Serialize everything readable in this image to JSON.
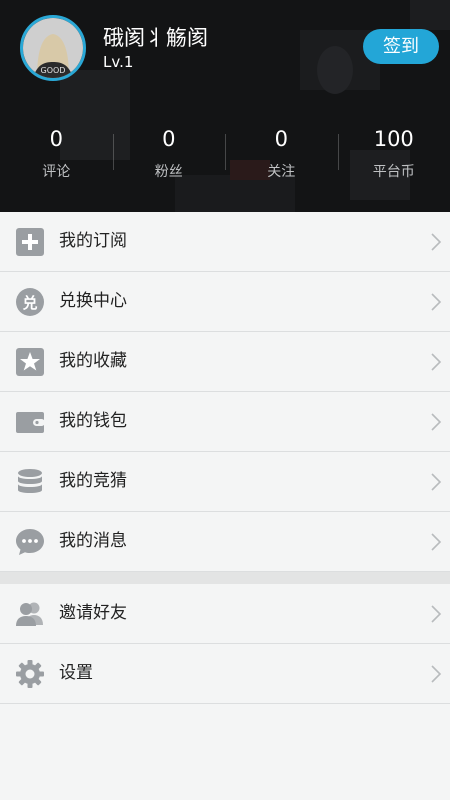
{
  "profile": {
    "username": "硪阂丬觞阂",
    "level": "Lv.1",
    "signin_label": "签到"
  },
  "stats": [
    {
      "value": "0",
      "label": "评论"
    },
    {
      "value": "0",
      "label": "粉丝"
    },
    {
      "value": "0",
      "label": "关注"
    },
    {
      "value": "100",
      "label": "平台币"
    }
  ],
  "menu": [
    {
      "label": "我的订阅",
      "icon": "plus-icon"
    },
    {
      "label": "兑换中心",
      "icon": "exchange-icon"
    },
    {
      "label": "我的收藏",
      "icon": "star-icon"
    },
    {
      "label": "我的钱包",
      "icon": "wallet-icon"
    },
    {
      "label": "我的竞猜",
      "icon": "database-icon"
    },
    {
      "label": "我的消息",
      "icon": "message-icon"
    }
  ],
  "menu2": [
    {
      "label": "邀请好友",
      "icon": "users-icon"
    },
    {
      "label": "设置",
      "icon": "gear-icon"
    }
  ],
  "colors": {
    "accent": "#23a6d7",
    "icon_gray": "#9a9ea2"
  }
}
